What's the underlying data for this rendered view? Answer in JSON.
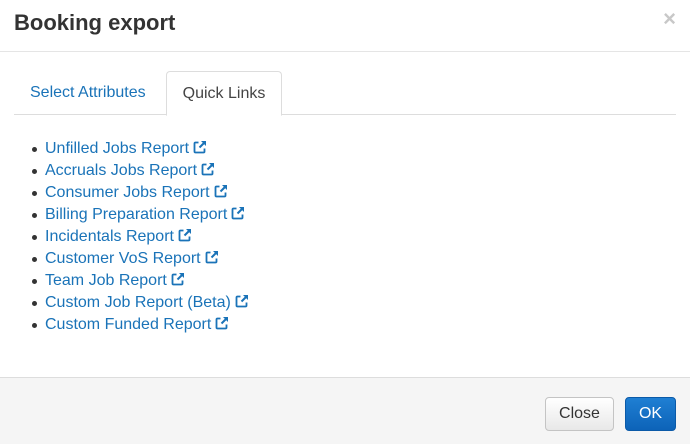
{
  "dialog": {
    "title": "Booking export",
    "close_glyph": "×"
  },
  "tabs": [
    {
      "label": "Select Attributes",
      "active": false
    },
    {
      "label": "Quick Links",
      "active": true
    }
  ],
  "quick_links": [
    {
      "label": "Unfilled Jobs Report",
      "icon": "external-link-icon"
    },
    {
      "label": "Accruals Jobs Report",
      "icon": "external-link-icon"
    },
    {
      "label": "Consumer Jobs Report",
      "icon": "external-link-icon"
    },
    {
      "label": "Billing Preparation Report",
      "icon": "external-link-icon"
    },
    {
      "label": "Incidentals Report",
      "icon": "external-link-icon"
    },
    {
      "label": "Customer VoS Report",
      "icon": "external-link-icon"
    },
    {
      "label": "Team Job Report",
      "icon": "external-link-icon"
    },
    {
      "label": "Custom Job Report (Beta)",
      "icon": "external-link-icon"
    },
    {
      "label": "Custom Funded Report",
      "icon": "external-link-icon"
    }
  ],
  "footer": {
    "close_label": "Close",
    "ok_label": "OK"
  },
  "colors": {
    "link": "#1a73b8",
    "primary_button": "#0d63b8",
    "footer_bg": "#f5f5f5"
  }
}
